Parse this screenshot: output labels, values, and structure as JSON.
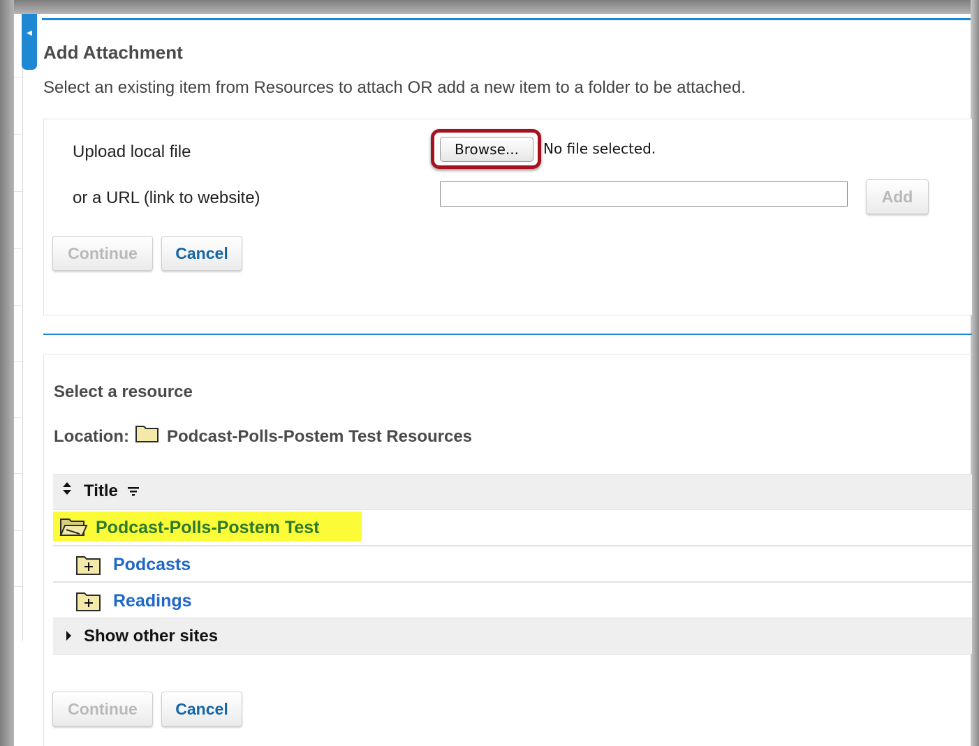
{
  "dialog": {
    "title": "Add Attachment",
    "instructions": "Select an existing item from Resources to attach OR add a new item to a folder to be attached."
  },
  "upload": {
    "local_label": "Upload local file",
    "browse_label": "Browse...",
    "file_status": "No file selected.",
    "url_label": "or a URL (link to website)",
    "url_value": "",
    "add_label": "Add"
  },
  "buttons": {
    "continue_label": "Continue",
    "cancel_label": "Cancel"
  },
  "resources": {
    "heading": "Select a resource",
    "location_label": "Location:",
    "location_value": "Podcast-Polls-Postem Test Resources",
    "column_title": "Title",
    "root_folder": "Podcast-Polls-Postem Test",
    "items": [
      {
        "label": "Podcasts"
      },
      {
        "label": "Readings"
      }
    ],
    "show_other_sites": "Show other sites"
  },
  "colors": {
    "accent_blue": "#1f88d3",
    "highlight_red": "#a3121e",
    "highlight_yellow": "#fbfb38",
    "root_green": "#2c7a2c",
    "link_blue": "#1f67c9"
  }
}
